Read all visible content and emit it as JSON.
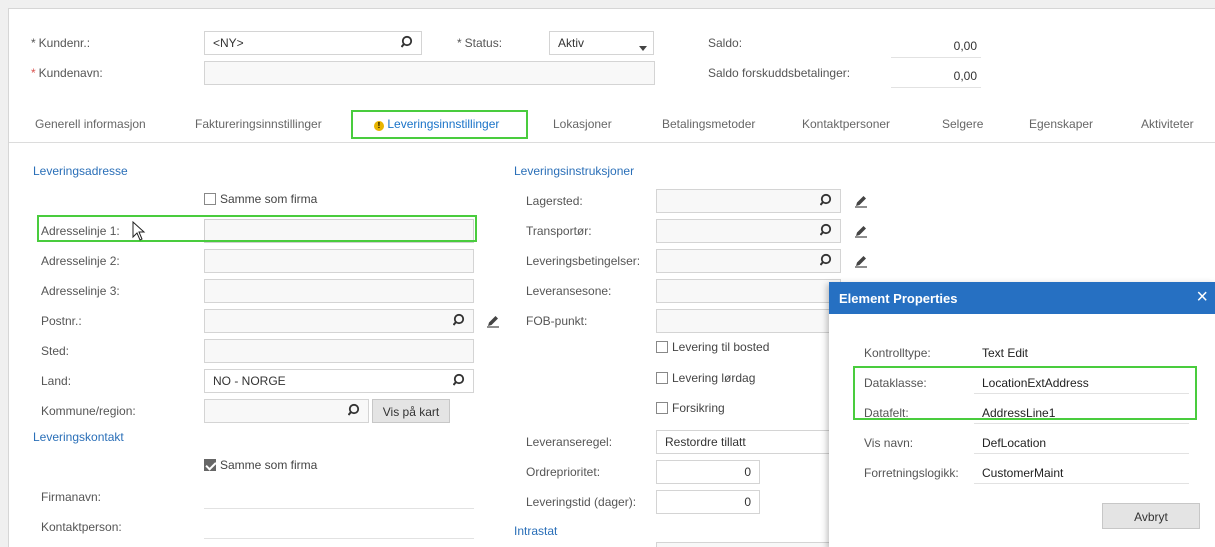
{
  "header": {
    "kundenr_label": "Kundenr.:",
    "kundenr_value": "<NY>",
    "status_label": "Status:",
    "status_value": "Aktiv",
    "saldo_label": "Saldo:",
    "saldo_value": "0,00",
    "kundenavn_label": "Kundenavn:",
    "kundenavn_value": "",
    "saldo_forskudd_label": "Saldo forskuddsbetalinger:",
    "saldo_forskudd_value": "0,00"
  },
  "tabs": [
    {
      "label": "Generell informasjon"
    },
    {
      "label": "Faktureringsinnstillinger"
    },
    {
      "label": "Leveringsinnstillinger"
    },
    {
      "label": "Lokasjoner"
    },
    {
      "label": "Betalingsmetoder"
    },
    {
      "label": "Kontaktpersoner"
    },
    {
      "label": "Selgere"
    },
    {
      "label": "Egenskaper"
    },
    {
      "label": "Aktiviteter"
    }
  ],
  "leveringsadresse": {
    "title": "Leveringsadresse",
    "same_as_company": "Samme som firma",
    "adresselinje1_label": "Adresselinje 1:",
    "adresselinje2_label": "Adresselinje 2:",
    "adresselinje3_label": "Adresselinje 3:",
    "postnr_label": "Postnr.:",
    "sted_label": "Sted:",
    "land_label": "Land:",
    "land_value": "NO - NORGE",
    "kommune_label": "Kommune/region:",
    "vis_paa_kart": "Vis på kart"
  },
  "leveringskontakt": {
    "title": "Leveringskontakt",
    "same_as_company": "Samme som firma",
    "firmanavn_label": "Firmanavn:",
    "kontaktperson_label": "Kontaktperson:"
  },
  "leveringsinstruksjoner": {
    "title": "Leveringsinstruksjoner",
    "lagersted_label": "Lagersted:",
    "transportor_label": "Transportør:",
    "leveringsbetingelser_label": "Leveringsbetingelser:",
    "leveransesone_label": "Leveransesone:",
    "fob_label": "FOB-punkt:",
    "levering_bosted": "Levering til bosted",
    "levering_lordag": "Levering lørdag",
    "forsikring": "Forsikring",
    "leveranseregel_label": "Leveranseregel:",
    "leveranseregel_value": "Restordre tillatt",
    "ordreprioritet_label": "Ordreprioritet:",
    "ordreprioritet_value": "0",
    "leveringstid_label": "Leveringstid (dager):",
    "leveringstid_value": "0"
  },
  "intrastat": {
    "title": "Intrastat"
  },
  "dialog": {
    "title": "Element Properties",
    "close": "×",
    "rows": [
      {
        "label": "Kontrolltype:",
        "value": "Text Edit"
      },
      {
        "label": "Dataklasse:",
        "value": "LocationExtAddress"
      },
      {
        "label": "Datafelt:",
        "value": "AddressLine1"
      },
      {
        "label": "Vis navn:",
        "value": "DefLocation"
      },
      {
        "label": "Forretningslogikk:",
        "value": "CustomerMaint"
      }
    ],
    "cancel_label": "Avbryt"
  },
  "colors": {
    "accent": "#2670c2",
    "highlight": "#49cc3d",
    "section_title": "#2a6fb8",
    "required": "#d9534f"
  }
}
